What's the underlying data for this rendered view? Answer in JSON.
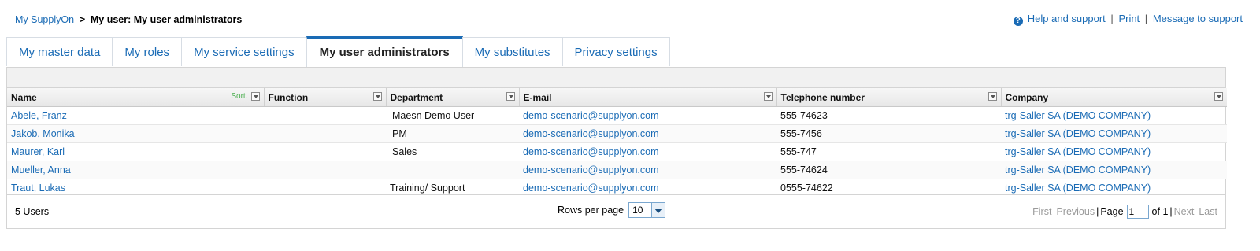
{
  "breadcrumb": {
    "home": "My SupplyOn",
    "separator": ">",
    "current": "My user: My user administrators"
  },
  "help_links": {
    "help_icon": "question-circle-icon",
    "help": "Help and support",
    "print": "Print",
    "message": "Message to support",
    "pipe": "|"
  },
  "tabs": [
    {
      "label": "My master data",
      "active": false
    },
    {
      "label": "My roles",
      "active": false
    },
    {
      "label": "My service settings",
      "active": false
    },
    {
      "label": "My user administrators",
      "active": true
    },
    {
      "label": "My substitutes",
      "active": false
    },
    {
      "label": "Privacy settings",
      "active": false
    }
  ],
  "table": {
    "sort_label": "Sort.",
    "columns": [
      "Name",
      "Function",
      "Department",
      "E-mail",
      "Telephone number",
      "Company"
    ],
    "rows": [
      {
        "name": "Abele, Franz",
        "function": "",
        "department": "Maesn Demo User",
        "email": "demo-scenario@supplyon.com",
        "phone": "555-74623",
        "company": "trg-Saller SA (DEMO COMPANY)"
      },
      {
        "name": "Jakob, Monika",
        "function": "",
        "department": "PM",
        "email": "demo-scenario@supplyon.com",
        "phone": "555-7456",
        "company": "trg-Saller SA (DEMO COMPANY)"
      },
      {
        "name": "Maurer, Karl",
        "function": "",
        "department": "Sales",
        "email": "demo-scenario@supplyon.com",
        "phone": "555-747",
        "company": "trg-Saller SA (DEMO COMPANY)"
      },
      {
        "name": "Mueller, Anna",
        "function": "",
        "department": "",
        "email": "demo-scenario@supplyon.com",
        "phone": "555-74624",
        "company": "trg-Saller SA (DEMO COMPANY)"
      },
      {
        "name": "Traut, Lukas",
        "function": "",
        "department": "Training/ Support",
        "email": "demo-scenario@supplyon.com",
        "phone": "0555-74622",
        "company": "trg-Saller SA (DEMO COMPANY)"
      }
    ]
  },
  "footer": {
    "count": "5 Users",
    "rows_per_page_label": "Rows per page",
    "rows_per_page_value": "10",
    "first": "First",
    "previous": "Previous",
    "page_label": "Page",
    "page_value": "1",
    "of_label": "of 1",
    "next": "Next",
    "last": "Last",
    "bar": "|"
  },
  "colors": {
    "link": "#1a6bb5",
    "sort_link": "#4caf50",
    "active_tab_border": "#1a6bb5"
  }
}
